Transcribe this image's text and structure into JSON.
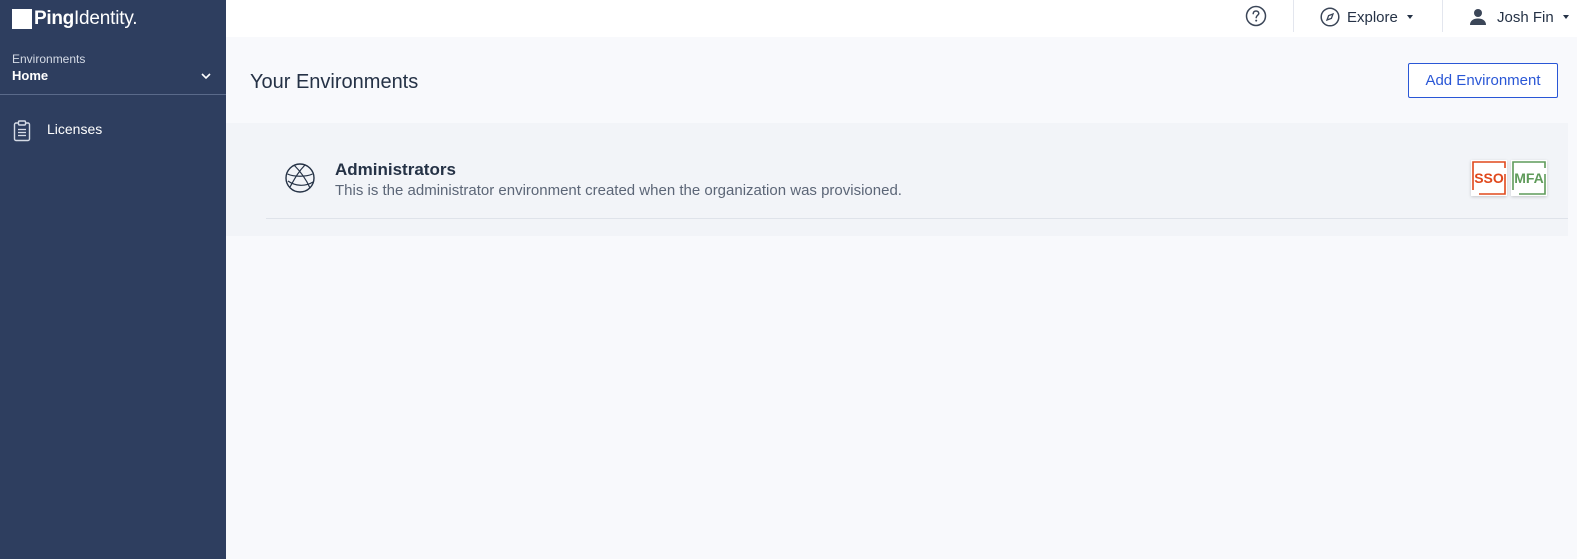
{
  "brand": {
    "logo_bold": "Ping",
    "logo_regular": "Identity."
  },
  "sidebar": {
    "environment_selector": {
      "label": "Environments",
      "value": "Home"
    },
    "items": [
      {
        "label": "Licenses",
        "icon": "clipboard-icon"
      }
    ]
  },
  "topbar": {
    "help_icon": "help-circle-icon",
    "explore_label": "Explore",
    "user_name": "Josh Fin"
  },
  "main": {
    "title": "Your Environments",
    "add_button_label": "Add Environment",
    "environments": [
      {
        "name": "Administrators",
        "description": "This is the administrator environment created when the organization was provisioned.",
        "icon": "globe-icon",
        "badges": [
          {
            "label": "SSO",
            "color": "#e0481c"
          },
          {
            "label": "MFA",
            "color": "#5f9b5a"
          }
        ]
      }
    ]
  },
  "colors": {
    "sidebar_bg": "#2e3e5f",
    "accent": "#2a57d6"
  }
}
